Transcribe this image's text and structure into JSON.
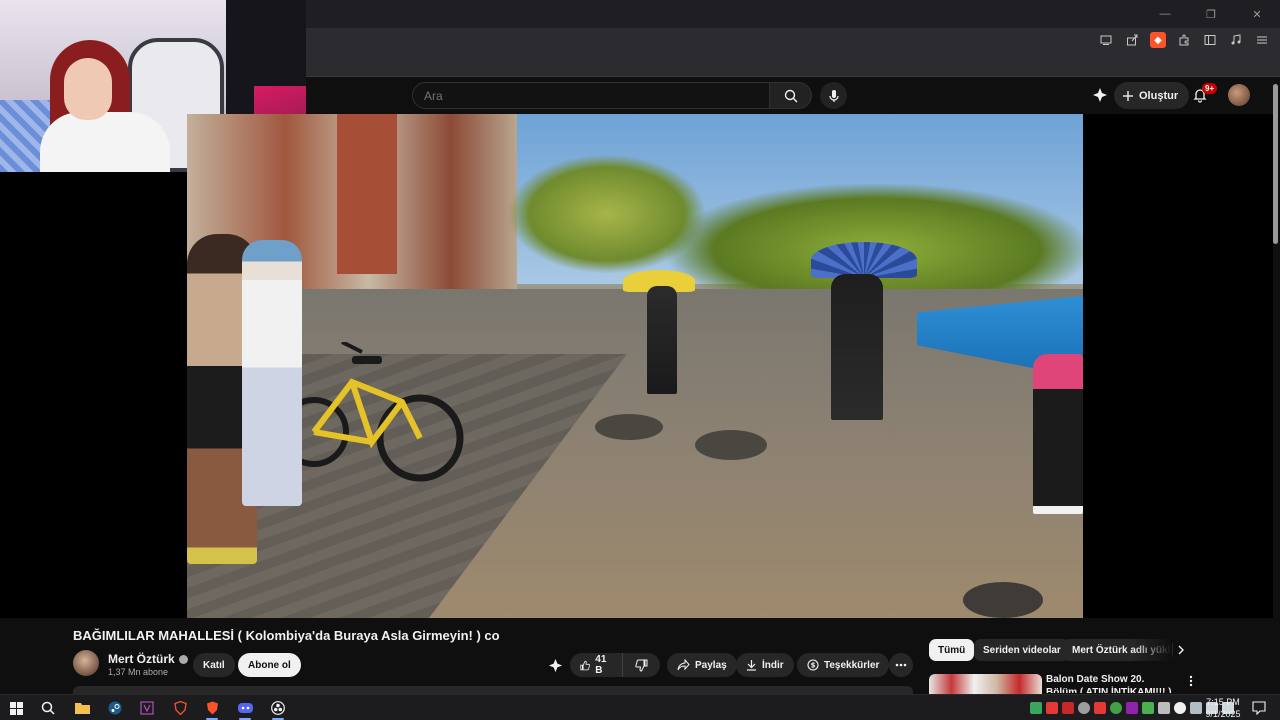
{
  "browser": {
    "window_controls": {
      "minimize": "—",
      "restore": "❐",
      "close": "✕"
    },
    "toolbar_icons": [
      "cast-icon",
      "share-icon",
      "brave-shield-icon",
      "extensions-icon",
      "sidebar-icon",
      "media-icon",
      "menu-icon"
    ]
  },
  "youtube": {
    "search": {
      "placeholder": "Ara"
    },
    "create_label": "Oluştur",
    "notification_count": "9+"
  },
  "video": {
    "title": "BAĞIMLILAR MAHALLESİ ( Kolombiya'da Buraya Asla Girmeyin! ) co"
  },
  "channel": {
    "name": "Mert Öztürk",
    "subscribers": "1,37 Mn abone",
    "join_label": "Katıl",
    "subscribe_label": "Abone ol"
  },
  "actions": {
    "like_count": "41 B",
    "share_label": "Paylaş",
    "download_label": "İndir",
    "thanks_label": "Teşekkürler"
  },
  "chips": [
    {
      "label": "Tümü",
      "active": true
    },
    {
      "label": "Seriden videolar",
      "active": false
    },
    {
      "label": "Mert Öztürk adlı yükl",
      "active": false
    }
  ],
  "recommendation": {
    "title": "Balon Date Show 20. Bölüm ( ATIN İNTİKAMI!!! )"
  },
  "taskbar": {
    "apps": [
      "windows-start-icon",
      "search-icon",
      "file-explorer-icon",
      "steam-icon",
      "vlc-icon",
      "brave-icon",
      "brave-active-icon",
      "discord-icon",
      "obs-icon"
    ],
    "time": "7:15 PM",
    "date": "9/1/2025"
  },
  "colors": {
    "background": "#0f0f0f",
    "chip_active": "#f1f1f1",
    "pill": "#272727",
    "notification_badge": "#cc0000",
    "brave_orange": "#fb542b"
  }
}
